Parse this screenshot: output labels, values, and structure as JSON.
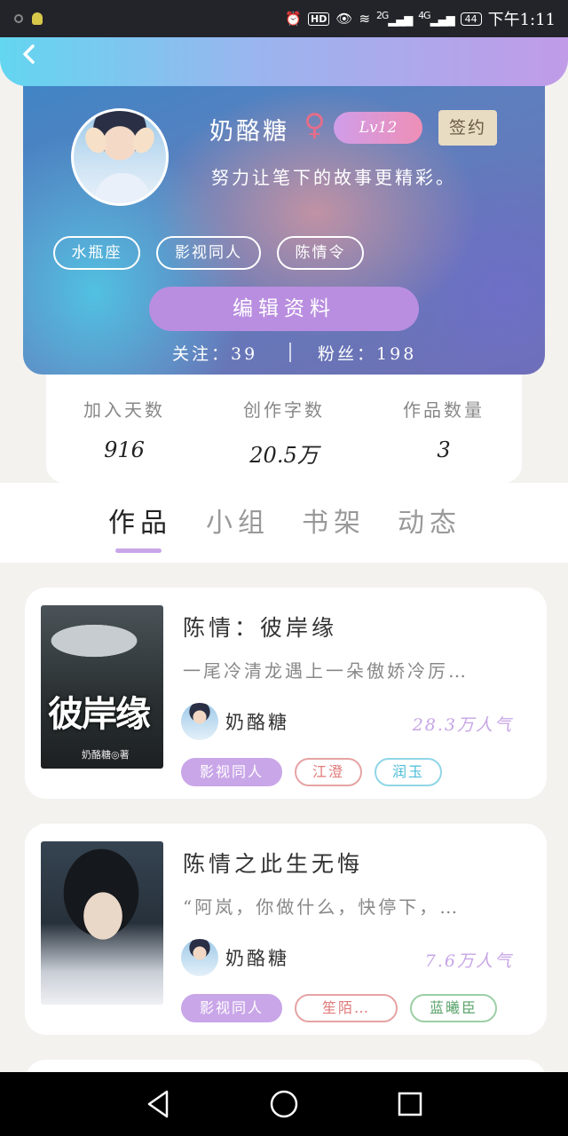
{
  "status_bar": {
    "time": "下午1:11",
    "hd": "HD",
    "net1": "2G",
    "net2": "4G",
    "battery": "44"
  },
  "profile": {
    "name": "奶酪糖",
    "gender_symbol": "♀",
    "level": "Lv12",
    "sign_badge": "签约",
    "bio": "努力让笔下的故事更精彩。",
    "tags": [
      "水瓶座",
      "影视同人",
      "陈情令"
    ],
    "edit_button": "编辑资料",
    "following_label": "关注：",
    "following_count": "39",
    "fans_label": "粉丝：",
    "fans_count": "198"
  },
  "stats": [
    {
      "label": "加入天数",
      "value": "916"
    },
    {
      "label": "创作字数",
      "value": "20.5万"
    },
    {
      "label": "作品数量",
      "value": "3"
    }
  ],
  "tabs": [
    {
      "label": "作品",
      "active": true
    },
    {
      "label": "小组",
      "active": false
    },
    {
      "label": "书架",
      "active": false
    },
    {
      "label": "动态",
      "active": false
    }
  ],
  "works": [
    {
      "title": "陈情：彼岸缘",
      "description": "一尾冷清龙遇上一朵傲娇冷厉…",
      "author": "奶酪糖",
      "popularity": "28.3万人气",
      "cover_title": "彼岸缘",
      "cover_author": "奶酪糖◎著",
      "tags": [
        {
          "label": "影视同人",
          "style": "fill"
        },
        {
          "label": "江澄",
          "style": "red"
        },
        {
          "label": "润玉",
          "style": "cyan"
        }
      ]
    },
    {
      "title": "陈情之此生无悔",
      "description": "“阿岚，你做什么，快停下，…",
      "author": "奶酪糖",
      "popularity": "7.6万人气",
      "tags": [
        {
          "label": "影视同人",
          "style": "fill"
        },
        {
          "label": "笙陌…",
          "style": "red"
        },
        {
          "label": "蓝曦臣",
          "style": "green"
        }
      ]
    }
  ],
  "colors": {
    "accent_purple": "#c9a6e8",
    "header_start": "#63d6f0",
    "header_end": "#c19be8"
  }
}
